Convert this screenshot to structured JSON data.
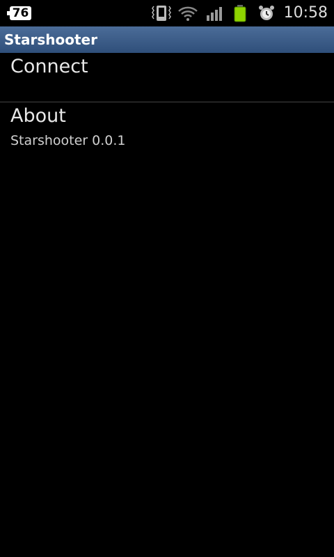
{
  "status_bar": {
    "notification_count": "76",
    "time": "10:58",
    "battery_color": "#8fd400"
  },
  "app_bar": {
    "title": "Starshooter"
  },
  "preferences": [
    {
      "title": "Connect",
      "summary": ""
    },
    {
      "title": "About",
      "summary": "Starshooter 0.0.1"
    }
  ]
}
